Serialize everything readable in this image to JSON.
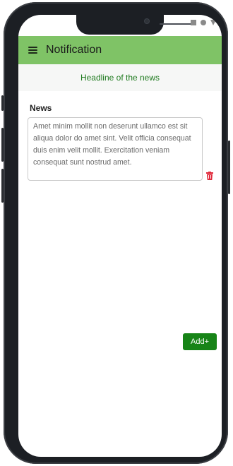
{
  "appbar": {
    "title": "Notification",
    "color": "#7fc366"
  },
  "headline": {
    "text": "Headline of the news",
    "color": "#1f7a1f"
  },
  "news": {
    "label": "News",
    "value": "Amet minim mollit non deserunt ullamco est sit aliqua dolor do amet sint. Velit officia consequat duis enim velit mollit. Exercitation veniam consequat sunt nostrud amet."
  },
  "actions": {
    "add_label": "Add+",
    "add_color": "#178417",
    "delete_color": "#e0293a"
  },
  "icons": {
    "menu": "hamburger-menu-icon",
    "delete": "trash-icon"
  }
}
